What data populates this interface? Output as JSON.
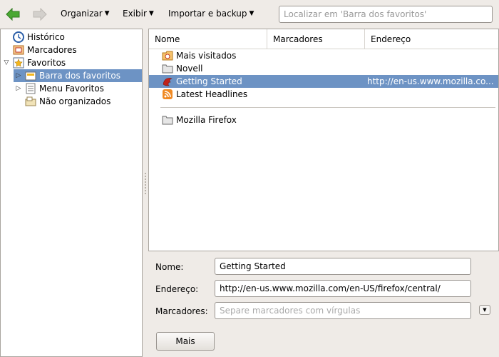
{
  "toolbar": {
    "menus": [
      {
        "label": "Organizar",
        "mnemonic": "O"
      },
      {
        "label": "Exibir",
        "mnemonic": "x"
      },
      {
        "label": "Importar e backup",
        "mnemonic": "I"
      }
    ],
    "search_placeholder": "Localizar em 'Barra dos favoritos'"
  },
  "tree": {
    "items": [
      {
        "label": "Histórico",
        "icon": "history-clock-icon"
      },
      {
        "label": "Marcadores",
        "icon": "tags-icon"
      },
      {
        "label": "Favoritos",
        "icon": "bookmarks-star-icon",
        "expanded": true
      },
      {
        "label": "Barra dos favoritos",
        "icon": "bookmarks-toolbar-icon",
        "selected": true
      },
      {
        "label": "Menu Favoritos",
        "icon": "bookmarks-menu-icon"
      },
      {
        "label": "Não organizados",
        "icon": "unsorted-bookmarks-icon"
      }
    ]
  },
  "list": {
    "columns": [
      "Nome",
      "Marcadores",
      "Endereço"
    ],
    "rows": [
      {
        "name": "Mais visitados",
        "url": "",
        "icon": "smart-folder-icon"
      },
      {
        "name": "Novell",
        "url": "",
        "icon": "folder-icon"
      },
      {
        "name": "Getting Started",
        "url": "http://en-us.www.mozilla.co...",
        "icon": "firefox-bookmark-icon",
        "selected": true
      },
      {
        "name": "Latest Headlines",
        "url": "",
        "icon": "rss-feed-icon"
      },
      {
        "name": "Mozilla Firefox",
        "url": "",
        "icon": "folder-icon"
      }
    ]
  },
  "details": {
    "name_label": "Nome:",
    "name_value": "Getting Started",
    "address_label": "Endereço:",
    "address_value": "http://en-us.www.mozilla.com/en-US/firefox/central/",
    "tags_label": "Marcadores:",
    "tags_placeholder": "Separe marcadores com vírgulas",
    "more_button": "Mais"
  },
  "colors": {
    "selection": "#6d93c4",
    "window_bg": "#efebe7",
    "back_arrow": "#3f9c2a"
  }
}
